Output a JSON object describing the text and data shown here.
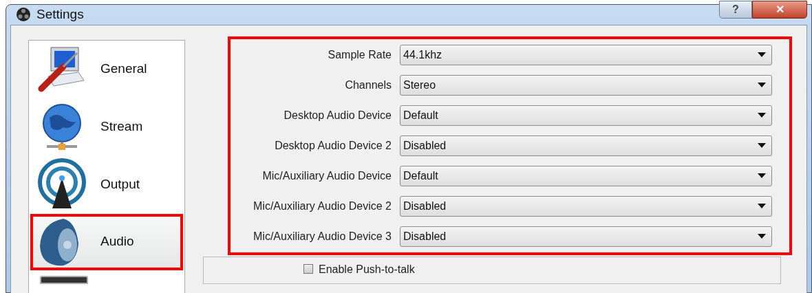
{
  "window": {
    "title": "Settings",
    "help_button": "?",
    "close_button": "✕"
  },
  "sidebar": {
    "items": [
      {
        "label": "General",
        "kind": "general",
        "selected": false
      },
      {
        "label": "Stream",
        "kind": "stream",
        "selected": false
      },
      {
        "label": "Output",
        "kind": "output",
        "selected": false
      },
      {
        "label": "Audio",
        "kind": "audio",
        "selected": true
      }
    ]
  },
  "audio_settings": [
    {
      "label": "Sample Rate",
      "value": "44.1khz"
    },
    {
      "label": "Channels",
      "value": "Stereo"
    },
    {
      "label": "Desktop Audio Device",
      "value": "Default"
    },
    {
      "label": "Desktop Audio Device 2",
      "value": "Disabled"
    },
    {
      "label": "Mic/Auxiliary Audio Device",
      "value": "Default"
    },
    {
      "label": "Mic/Auxiliary Audio Device 2",
      "value": "Disabled"
    },
    {
      "label": "Mic/Auxiliary Audio Device 3",
      "value": "Disabled"
    }
  ],
  "push_to_talk": {
    "label": "Enable Push-to-talk",
    "checked": false
  }
}
